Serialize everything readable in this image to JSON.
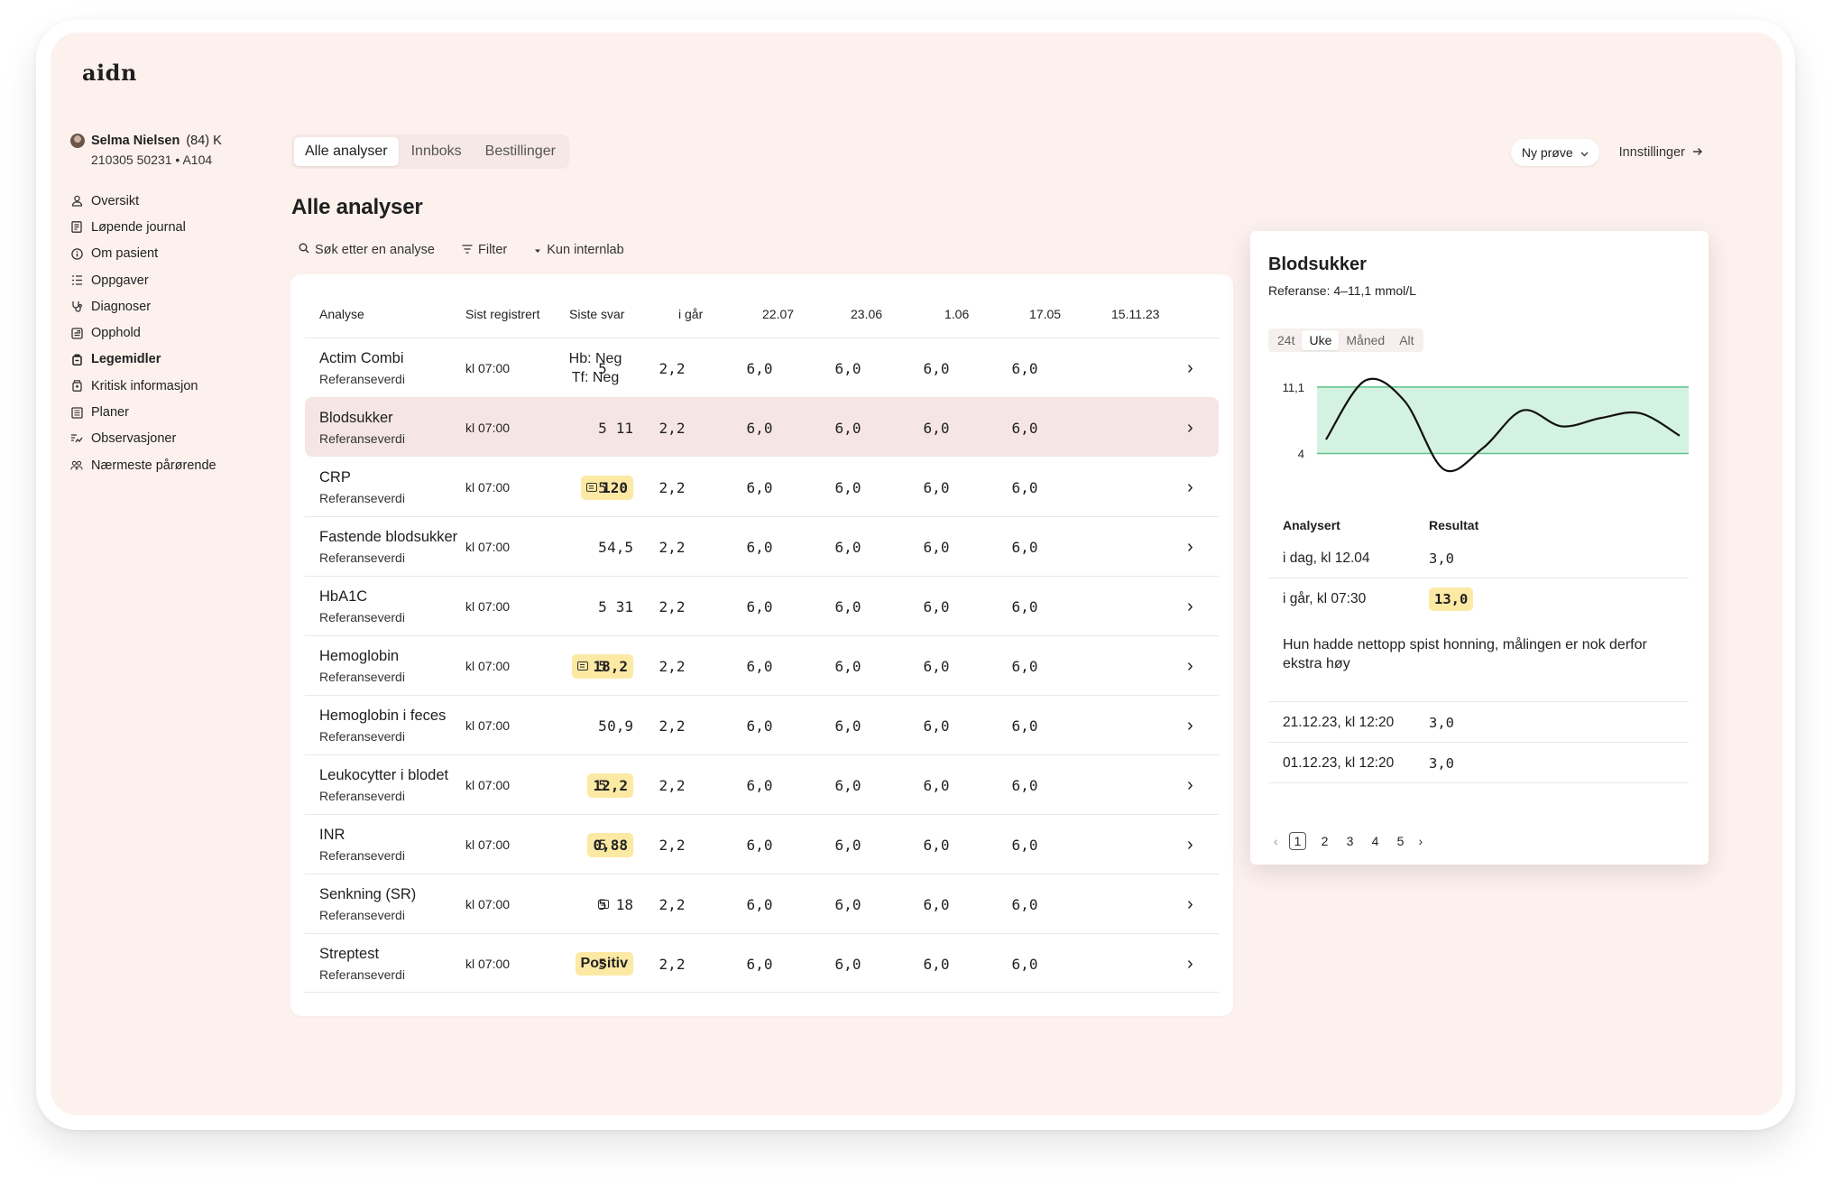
{
  "app": {
    "logo": "aidn"
  },
  "patient": {
    "name": "Selma Nielsen",
    "age_sex": "(84) K",
    "id_line": "210305 50231 • A104"
  },
  "sidebar": {
    "items": [
      {
        "label": "Oversikt",
        "icon": "user-icon"
      },
      {
        "label": "Løpende journal",
        "icon": "journal-icon"
      },
      {
        "label": "Om pasient",
        "icon": "info-icon"
      },
      {
        "label": "Oppgaver",
        "icon": "tasks-icon"
      },
      {
        "label": "Diagnoser",
        "icon": "diagnosis-icon"
      },
      {
        "label": "Opphold",
        "icon": "stay-icon"
      },
      {
        "label": "Legemidler",
        "icon": "medicine-icon",
        "active": true
      },
      {
        "label": "Kritisk informasjon",
        "icon": "critical-icon"
      },
      {
        "label": "Planer",
        "icon": "plans-icon"
      },
      {
        "label": "Observasjoner",
        "icon": "observations-icon"
      },
      {
        "label": "Nærmeste pårørende",
        "icon": "relatives-icon"
      }
    ]
  },
  "header": {
    "tabs": [
      "Alle analyser",
      "Innboks",
      "Bestillinger"
    ],
    "new_sample": "Ny prøve",
    "settings": "Innstillinger"
  },
  "main": {
    "title": "Alle analyser",
    "search": "Søk etter en analyse",
    "filter": "Filter",
    "internal": "Kun internlab",
    "columns": [
      "Analyse",
      "Sist registrert",
      "Siste svar",
      "i går",
      "22.07",
      "23.06",
      "1.06",
      "17.05",
      "15.11.23"
    ],
    "rows": [
      {
        "name": "Actim Combi",
        "sub": "Referanseverdi",
        "reg": "kl 07:00",
        "last1": "Hb: Neg",
        "last2": "Tf: Neg",
        "v": [
          "5",
          "2,2",
          "6,0",
          "6,0",
          "6,0",
          "6,0"
        ]
      },
      {
        "name": "Blodsukker",
        "sub": "Referanseverdi",
        "reg": "kl 07:00",
        "last": "11",
        "v": [
          "5",
          "2,2",
          "6,0",
          "6,0",
          "6,0",
          "6,0"
        ]
      },
      {
        "name": "CRP",
        "sub": "Referanseverdi",
        "reg": "kl 07:00",
        "last": "120",
        "v": [
          "5",
          "2,2",
          "6,0",
          "6,0",
          "6,0",
          "6,0"
        ]
      },
      {
        "name": "Fastende blodsukker",
        "sub": "Referanseverdi",
        "reg": "kl 07:00",
        "last": "4,5",
        "v": [
          "5",
          "2,2",
          "6,0",
          "6,0",
          "6,0",
          "6,0"
        ]
      },
      {
        "name": "HbA1C",
        "sub": "Referanseverdi",
        "reg": "kl 07:00",
        "last": "31",
        "v": [
          "5",
          "2,2",
          "6,0",
          "6,0",
          "6,0",
          "6,0"
        ]
      },
      {
        "name": "Hemoglobin",
        "sub": "Referanseverdi",
        "reg": "kl 07:00",
        "last": "18,2",
        "v": [
          "5",
          "2,2",
          "6,0",
          "6,0",
          "6,0",
          "6,0"
        ]
      },
      {
        "name": "Hemoglobin i feces",
        "sub": "Referanseverdi",
        "reg": "kl 07:00",
        "last": "0,9",
        "v": [
          "5",
          "2,2",
          "6,0",
          "6,0",
          "6,0",
          "6,0"
        ]
      },
      {
        "name": "Leukocytter i blodet",
        "sub": "Referanseverdi",
        "reg": "kl 07:00",
        "last": "12,2",
        "v": [
          "5",
          "2,2",
          "6,0",
          "6,0",
          "6,0",
          "6,0"
        ]
      },
      {
        "name": "INR",
        "sub": "Referanseverdi",
        "reg": "kl 07:00",
        "last": "0,88",
        "v": [
          "5",
          "2,2",
          "6,0",
          "6,0",
          "6,0",
          "6,0"
        ]
      },
      {
        "name": "Senkning (SR)",
        "sub": "Referanseverdi",
        "reg": "kl 07:00",
        "last": "18",
        "v": [
          "5",
          "2,2",
          "6,0",
          "6,0",
          "6,0",
          "6,0"
        ]
      },
      {
        "name": "Streptest",
        "sub": "Referanseverdi",
        "reg": "kl 07:00",
        "last": "Positiv",
        "v": [
          "5",
          "2,2",
          "6,0",
          "6,0",
          "6,0",
          "6,0"
        ]
      }
    ]
  },
  "detail": {
    "title": "Blodsukker",
    "reference": "Referanse: 4–11,1 mmol/L",
    "ranges": [
      "24t",
      "Uke",
      "Måned",
      "Alt"
    ],
    "y_labels": [
      "11,1",
      "4"
    ],
    "columns": [
      "Analysert",
      "Resultat"
    ],
    "results": [
      {
        "when": "i dag, kl 12.04",
        "value": "3,0"
      },
      {
        "when": "i går, kl 07:30",
        "value": "13,0"
      }
    ],
    "note": "Hun hadde nettopp spist honning, målingen er nok derfor ekstra høy",
    "results_more": [
      {
        "when": "21.12.23, kl 12:20",
        "value": "3,0"
      },
      {
        "when": "01.12.23, kl 12:20",
        "value": "3,0"
      }
    ],
    "pages": [
      "1",
      "2",
      "3",
      "4",
      "5"
    ],
    "current_page": "1"
  },
  "colors": {
    "background": "#fdf1ee",
    "badge": "#fce9a4",
    "selected_row": "#f5e6e4",
    "range_band": "#d4f2e1",
    "range_line": "#5cc38a"
  },
  "chart_data": {
    "type": "line",
    "reference_range": [
      4,
      11.1
    ],
    "y_ticks": [
      "11,1",
      "4"
    ],
    "series": [
      {
        "values": [
          5.5,
          11.8,
          9.6,
          2.3,
          4.6,
          8.6,
          6.9,
          7.8,
          8.3,
          5.9
        ]
      }
    ]
  }
}
